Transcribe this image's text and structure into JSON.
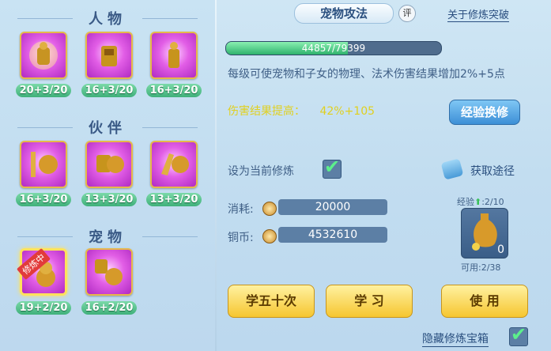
{
  "sections": {
    "person": "人物",
    "partner": "伙伴",
    "pet": "宠物"
  },
  "items": {
    "person": [
      "20+3/20",
      "16+3/20",
      "16+3/20"
    ],
    "partner": [
      "16+3/20",
      "13+3/20",
      "13+3/20"
    ],
    "pet": [
      "19+2/20",
      "16+2/20"
    ],
    "pet_tag": "修炼中"
  },
  "header": {
    "title": "宠物攻法",
    "review": "评",
    "about_link": "关于修炼突破"
  },
  "progress": {
    "text": "44857/79399",
    "value": 0.565
  },
  "description": "每级可使宠物和子女的物理、法术伤害结果增加2%+5点",
  "effect": {
    "label": "伤害结果提高：",
    "value": "42%+105"
  },
  "buttons": {
    "exp_exchange": "经验换修",
    "learn_fifty": "学五十次",
    "learn": "学 习",
    "use": "使 用",
    "get_way": "获取途径"
  },
  "set_current": "设为当前修炼",
  "cost": {
    "consume_label": "消耗:",
    "consume_value": "20000",
    "coin_label": "铜币:",
    "coin_value": "4532610"
  },
  "exp_item": {
    "exp_label": "经验",
    "exp_value": ":2/10",
    "count": "0",
    "usable": "可用:2/38"
  },
  "hide_box": "隐藏修炼宝箱",
  "colors": {
    "accent": "#3d8fd6",
    "gold": "#f6c630",
    "green": "#3fb07a"
  }
}
